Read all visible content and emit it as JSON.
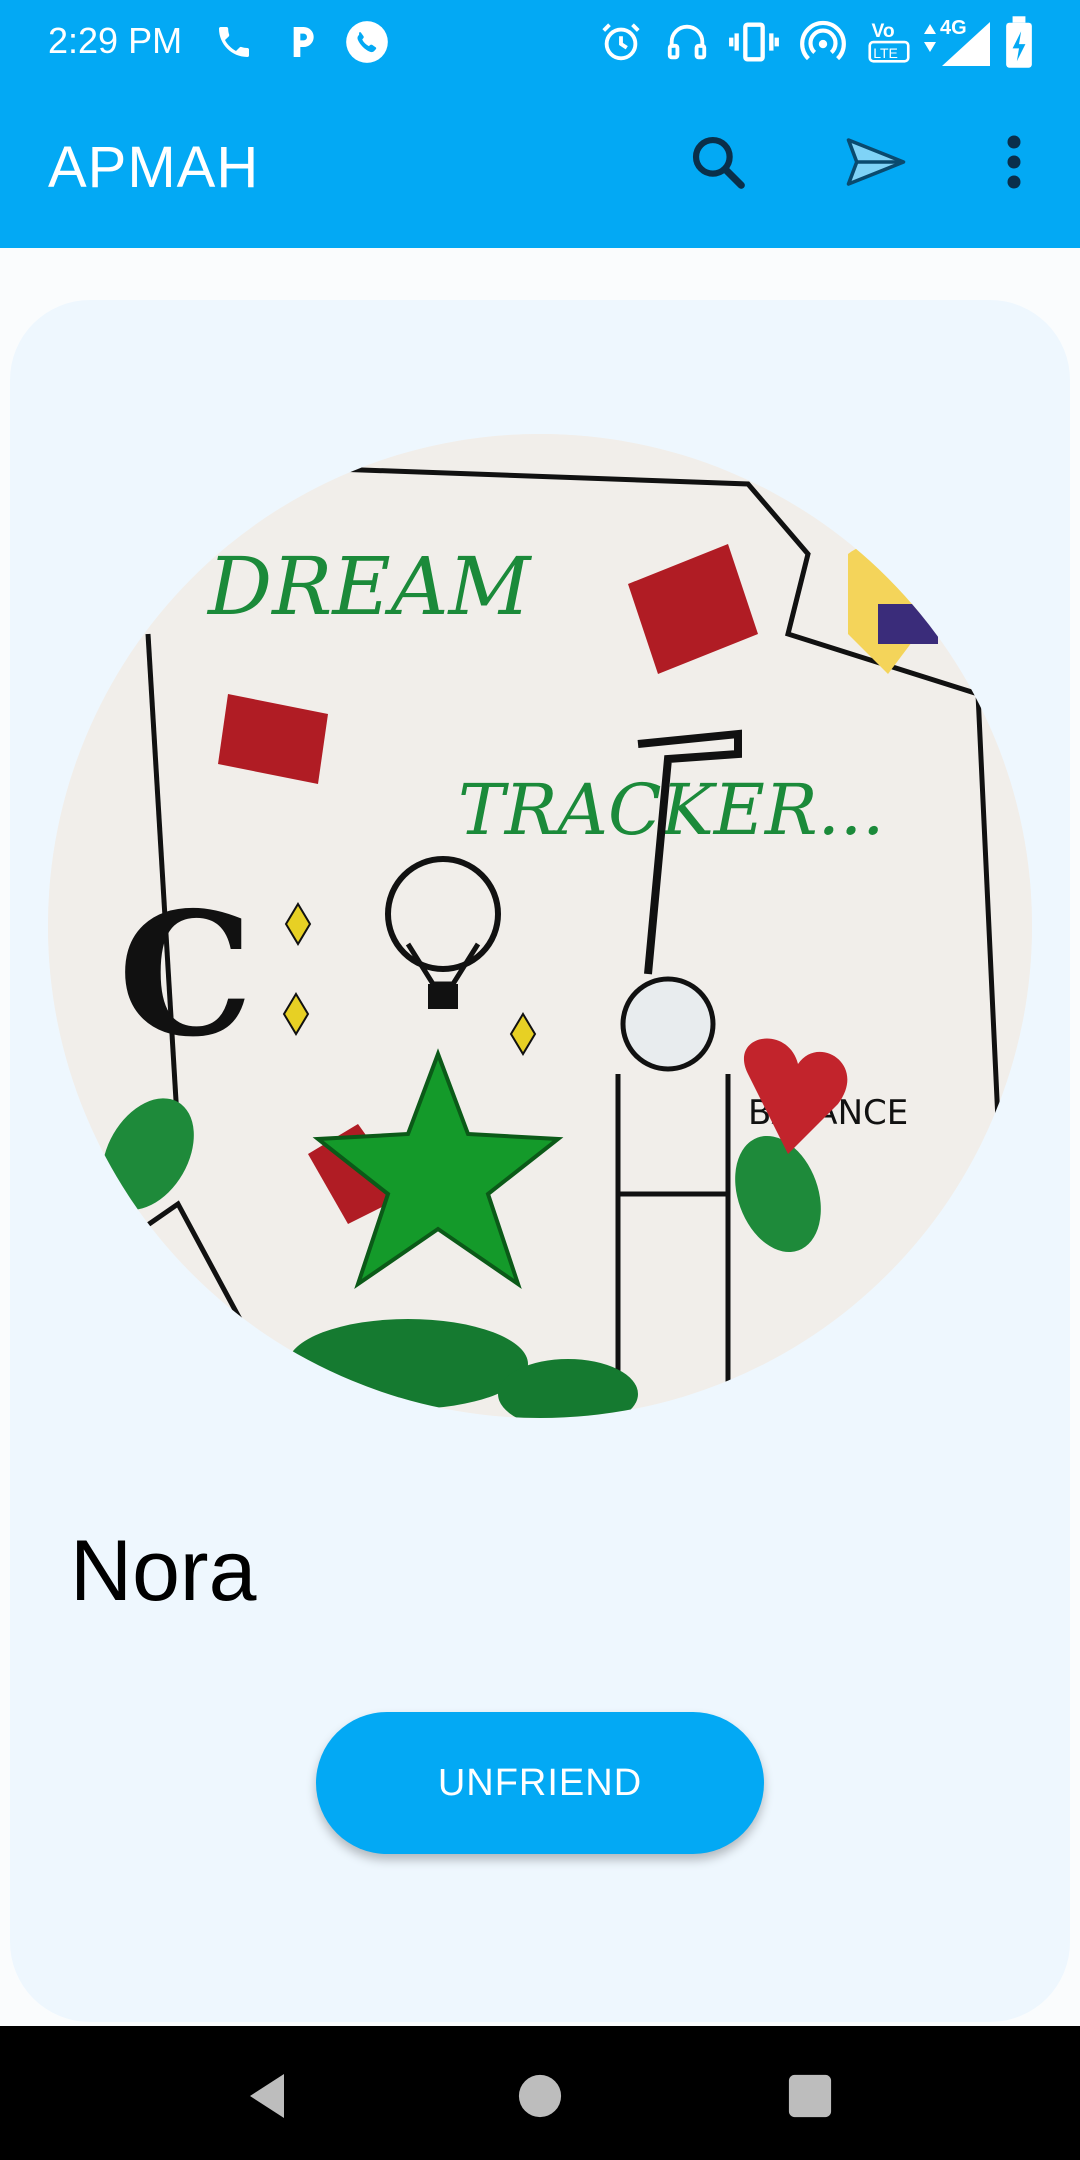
{
  "status_bar": {
    "time": "2:29 PM",
    "left_icons": [
      "phone-icon",
      "parking-icon",
      "whatsapp-icon"
    ],
    "right_icons": [
      "alarm-icon",
      "headset-icon",
      "vibrate-icon",
      "hotspot-icon",
      "volte-icon",
      "signal-icon",
      "battery-icon"
    ],
    "network": "4G"
  },
  "app_bar": {
    "title": "APMAH",
    "actions": [
      "search-icon",
      "send-icon",
      "more-vert-icon"
    ]
  },
  "profile": {
    "name": "Nora",
    "unfriend_label": "UNFRIEND"
  },
  "nav_bar": {
    "buttons": [
      "back-icon",
      "home-icon",
      "recents-icon"
    ]
  },
  "colors": {
    "primary": "#03a9f4",
    "card": "#eef7fe",
    "background": "#fafcfd"
  }
}
